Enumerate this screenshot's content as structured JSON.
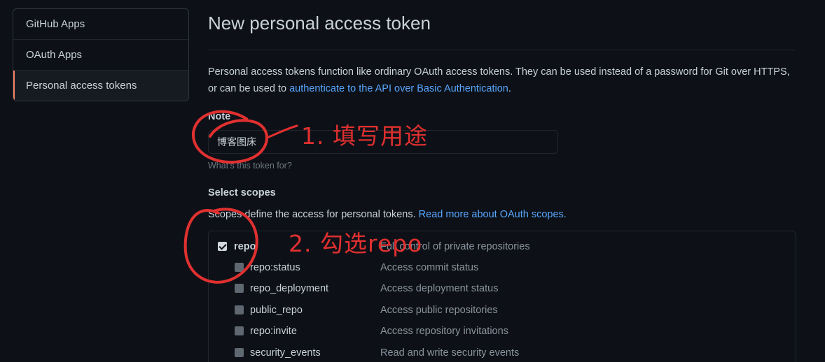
{
  "sidebar": {
    "items": [
      {
        "label": "GitHub Apps",
        "active": false
      },
      {
        "label": "OAuth Apps",
        "active": false
      },
      {
        "label": "Personal access tokens",
        "active": true
      }
    ]
  },
  "main": {
    "title": "New personal access token",
    "intro_text": "Personal access tokens function like ordinary OAuth access tokens. They can be used instead of a password for Git over HTTPS, or can be used to ",
    "intro_link": "authenticate to the API over Basic Authentication",
    "intro_end": ".",
    "note": {
      "label": "Note",
      "value": "博客图床",
      "hint": "What's this token for?"
    },
    "scopes": {
      "label": "Select scopes",
      "desc_text": "Scopes define the access for personal tokens. ",
      "desc_link": "Read more about OAuth scopes.",
      "items": [
        {
          "name": "repo",
          "desc": "Full control of private repositories",
          "checked": true,
          "level": 0
        },
        {
          "name": "repo:status",
          "desc": "Access commit status",
          "checked": true,
          "level": 1
        },
        {
          "name": "repo_deployment",
          "desc": "Access deployment status",
          "checked": true,
          "level": 1
        },
        {
          "name": "public_repo",
          "desc": "Access public repositories",
          "checked": true,
          "level": 1
        },
        {
          "name": "repo:invite",
          "desc": "Access repository invitations",
          "checked": true,
          "level": 1
        },
        {
          "name": "security_events",
          "desc": "Read and write security events",
          "checked": true,
          "level": 1
        }
      ]
    }
  },
  "annotations": {
    "step1": "1. 填写用途",
    "step2": "2. 勾选repo",
    "color": "#e03030"
  },
  "colors": {
    "background": "#0d1117",
    "link": "#58a6ff",
    "active_accent": "#f78166"
  }
}
